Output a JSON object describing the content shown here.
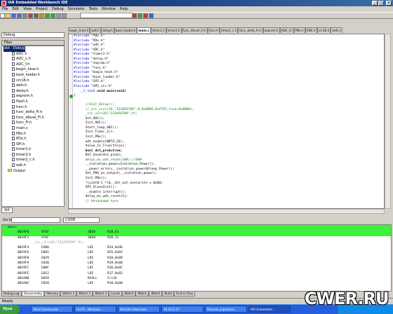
{
  "window": {
    "title": "IAR Embedded Workbench IDE",
    "minimize": "_",
    "maximize": "□",
    "close": "×"
  },
  "menu": [
    "File",
    "Edit",
    "View",
    "Project",
    "Debug",
    "Simulator",
    "Tools",
    "Window",
    "Help"
  ],
  "toolbar": {
    "icons": [
      "new-icon",
      "open-icon",
      "save-icon",
      "save-all-icon",
      "print-icon",
      "cut-icon",
      "copy-icon",
      "paste-icon",
      "undo-icon",
      "redo-icon",
      "find-icon",
      "replace-icon",
      "compile-icon",
      "make-icon",
      "stop-icon",
      "debug-icon",
      "breakpoint-icon",
      "step-icon"
    ]
  },
  "workspace": {
    "config": "Debug",
    "files_header": "Files",
    "tree": [
      {
        "label": "dst - Debug",
        "type": "root",
        "indent": 0
      },
      {
        "label": "ADC.h",
        "type": "file",
        "indent": 2
      },
      {
        "label": "ADC_c.h",
        "type": "file",
        "indent": 2
      },
      {
        "label": "ADC_f.h",
        "type": "file",
        "indent": 2
      },
      {
        "label": "begin_heat.h",
        "type": "file",
        "indent": 2
      },
      {
        "label": "boot_loader.h",
        "type": "file",
        "indent": 2
      },
      {
        "label": "crc16.h",
        "type": "file",
        "indent": 2
      },
      {
        "label": "defs.h",
        "type": "file",
        "indent": 2
      },
      {
        "label": "delay.h",
        "type": "file",
        "indent": 2
      },
      {
        "label": "eeprom.h",
        "type": "file",
        "indent": 2
      },
      {
        "label": "flash.h",
        "type": "file",
        "indent": 2
      },
      {
        "label": "func.h",
        "type": "file",
        "indent": 2
      },
      {
        "label": "func_delta_Fr.h",
        "type": "file",
        "indent": 2
      },
      {
        "label": "func_dlevel_Fr.h",
        "type": "file",
        "indent": 2
      },
      {
        "label": "func_Fr.h",
        "type": "file",
        "indent": 2
      },
      {
        "label": "main.c",
        "type": "file",
        "indent": 2
      },
      {
        "label": "PBx.h",
        "type": "file",
        "indent": 2
      },
      {
        "label": "PDx.h",
        "type": "file",
        "indent": 2
      },
      {
        "label": "SPI.h",
        "type": "file",
        "indent": 2
      },
      {
        "label": "timer1.h",
        "type": "file",
        "indent": 2
      },
      {
        "label": "timer2.h",
        "type": "file",
        "indent": 2
      },
      {
        "label": "timer2_c.h",
        "type": "file",
        "indent": 2
      },
      {
        "label": "wdt.h",
        "type": "file",
        "indent": 2
      },
      {
        "label": "Output",
        "type": "folder",
        "indent": 1
      }
    ],
    "bottom_tab": "dst"
  },
  "tabs": [
    {
      "label": "begin_heat.h",
      "active": false
    },
    {
      "label": "wdt.h",
      "active": false
    },
    {
      "label": "delay.h",
      "active": false
    },
    {
      "label": "boot_loader.h",
      "active": false
    },
    {
      "label": "main.c",
      "active": true
    },
    {
      "label": "timer1.h",
      "active": false
    },
    {
      "label": "timer2.h",
      "active": false
    },
    {
      "label": "func_dlevel_Fr.h",
      "active": false
    },
    {
      "label": "func.h",
      "active": false
    },
    {
      "label": "timer2_c.h",
      "active": false
    },
    {
      "label": "func_delta_Fr.h",
      "active": false
    },
    {
      "label": "eeprom.h",
      "active": false
    },
    {
      "label": "ADC_f.h",
      "active": false
    },
    {
      "label": "PBx.h",
      "active": false
    },
    {
      "label": "ADC.h",
      "active": false
    },
    {
      "label": "crc16.h",
      "active": false
    },
    {
      "label": "defs.h",
      "active": false
    }
  ],
  "code": [
    [
      {
        "t": "#include ",
        "c": "kw"
      },
      {
        "t": "\"PBx.h\""
      }
    ],
    [
      {
        "t": "#include ",
        "c": "kw"
      },
      {
        "t": "\"PDx.h\""
      }
    ],
    [
      {
        "t": "#include ",
        "c": "kw"
      },
      {
        "t": "\"wdt.h\""
      }
    ],
    [
      {
        "t": "#include ",
        "c": "kw"
      },
      {
        "t": "\"ADC.h\""
      }
    ],
    [
      {
        "t": "#include ",
        "c": "kw"
      },
      {
        "t": "\"timer2.h\""
      }
    ],
    [
      {
        "t": "#include ",
        "c": "kw"
      },
      {
        "t": "\"delay.h\""
      }
    ],
    [
      {
        "t": "#include ",
        "c": "kw"
      },
      {
        "t": "\"eeprom.h\""
      }
    ],
    [
      {
        "t": "#include ",
        "c": "kw"
      },
      {
        "t": "\"func.h\""
      }
    ],
    [
      {
        "t": "#include ",
        "c": "kw"
      },
      {
        "t": "\"begin_heat.h\""
      }
    ],
    [
      {
        "t": "#include ",
        "c": "kw"
      },
      {
        "t": "\"boot_loader.h\""
      }
    ],
    [
      {
        "t": "#include ",
        "c": "kw"
      },
      {
        "t": "\"SPI.h\""
      }
    ],
    [
      {
        "t": "#include ",
        "c": "kw"
      },
      {
        "t": "\"SPI_str.h\""
      }
    ],
    [
      {
        "t": "   __C_task ",
        "c": "kw"
      },
      {
        "t": "void main(void)",
        "c": "bold"
      }
    ],
    [
      {
        "t": "{"
      }
    ],
    [
      {
        "t": ""
      }
    ],
    [
      {
        "t": "      //Init_Delay();",
        "c": "cm"
      }
    ],
    [
      {
        "t": "      //_crc_=crc(16,\"123456789\",0,0x8005,0xFFFF,true,0x0000);",
        "c": "cm"
      }
    ],
    [
      {
        "t": "      _crc_=Crc16(\"123456789\",9);",
        "c": "cm"
      }
    ],
    [
      {
        "t": "      Set_ADC();"
      }
    ],
    [
      {
        "t": "      Init_ADC();"
      }
    ],
    [
      {
        "t": "      Start_loop_ADC();"
      }
    ],
    [
      {
        "t": "      Init_Timer_2();"
      }
    ],
    [
      {
        "t": "      Init_PBx();"
      }
    ],
    [
      {
        "t": "      wdt_enable(WDTO_2S);"
      }
    ],
    [
      {
        "t": "      Value_Is_True(false);"
      }
    ],
    [
      {
        "t": "      bool",
        "c": "bold"
      },
      {
        "t": " dst_prod=true;",
        "c": "bold"
      }
    ],
    [
      {
        "t": "      DST_Good(dst_prod);"
      }
    ],
    [
      {
        "t": "      delay_ms_wdt_reset(300);//600",
        "c": "cm"
      }
    ],
    [
      {
        "t": "      __isolation_power=Isolation_Power();"
      }
    ],
    [
      {
        "t": "      __power_error=__isolation_power&Sleep_Power();"
      }
    ],
    [
      {
        "t": "      Set_PBO_as_output(__isolation_power);"
      }
    ],
    [
      {
        "t": "      Init_PBx();"
      }
    ],
    [
      {
        "t": "      *(uint8_t *)&__dst_out_overwrite = 0x00;"
      }
    ],
    [
      {
        "t": "      SPI_SlaveInit();"
      }
    ],
    [
      {
        "t": "      __enable_interrupt();"
      }
    ],
    [
      {
        "t": "      delay_ms_wdt_reset(5);"
      }
    ],
    [
      {
        "t": "      // Начальный пуск",
        "c": "cm"
      }
    ]
  ],
  "disasm": {
    "goto_label": "Go to",
    "goto_value": "",
    "mode": "CODE",
    "header": "main:",
    "rows": [
      {
        "addr": "0019F0",
        "hex": "976F",
        "mn": "SBIW",
        "ops": "R28,63",
        "hl": true
      },
      {
        "addr": "0019F2",
        "hex": "976F",
        "mn": "SBIW",
        "ops": "R28,11",
        "hl": false
      },
      {
        "addr": "",
        "hex": "_crc_=Crc16(\"123456789\",9);",
        "mn": "",
        "ops": "",
        "hl": false,
        "src": true
      },
      {
        "addr": "0019F4",
        "hex": "E986",
        "mn": "LDI",
        "ops": "R24,0x96",
        "hl": false
      },
      {
        "addr": "0019F6",
        "hex": "E092",
        "mn": "LDI",
        "ops": "R25,0x02",
        "hl": false
      },
      {
        "addr": "0019F8",
        "hex": "E029",
        "mn": "LDI",
        "ops": "R18,0x09",
        "hl": false
      },
      {
        "addr": "0019FA",
        "hex": "E030",
        "mn": "LDI",
        "ops": "R19,0x00",
        "hl": false
      },
      {
        "addr": "0019FC",
        "hex": "E00C",
        "mn": "LDI",
        "ops": "R16,0x0C",
        "hl": false
      },
      {
        "addr": "0019FE",
        "hex": "E012",
        "mn": "LDI",
        "ops": "R17,0x02",
        "hl": false
      },
      {
        "addr": "001A00",
        "hex": "DAS9",
        "mn": "RCALL",
        "ops": "Crc16",
        "hl": false
      },
      {
        "addr": "001A02",
        "hex": "E020",
        "mn": "LDI",
        "ops": "R18,0x00",
        "hl": false
      }
    ],
    "bottom_tabs": [
      "Debug Log",
      "Disassembly",
      "Memory",
      "Watch 1",
      "Watch 2",
      "Watch 3",
      "Locals",
      "Watch",
      "Watch",
      "Watch",
      "Build",
      "Find in Files"
    ],
    "active_tab": "Disassembly"
  },
  "status": "Ready",
  "taskbar": {
    "start": "Пуск",
    "tasks": [
      {
        "label": "Total Commander ...",
        "active": false
      },
      {
        "label": "Far70 - Windows ...",
        "active": false
      },
      {
        "label": "Remote Administr...",
        "active": false
      },
      {
        "label": "10.23.5.17",
        "active": false
      },
      {
        "label": "Панель управлен...",
        "active": false
      },
      {
        "label": "IAR Embedded ...",
        "active": true
      }
    ]
  },
  "watermark": "CWER.RU"
}
